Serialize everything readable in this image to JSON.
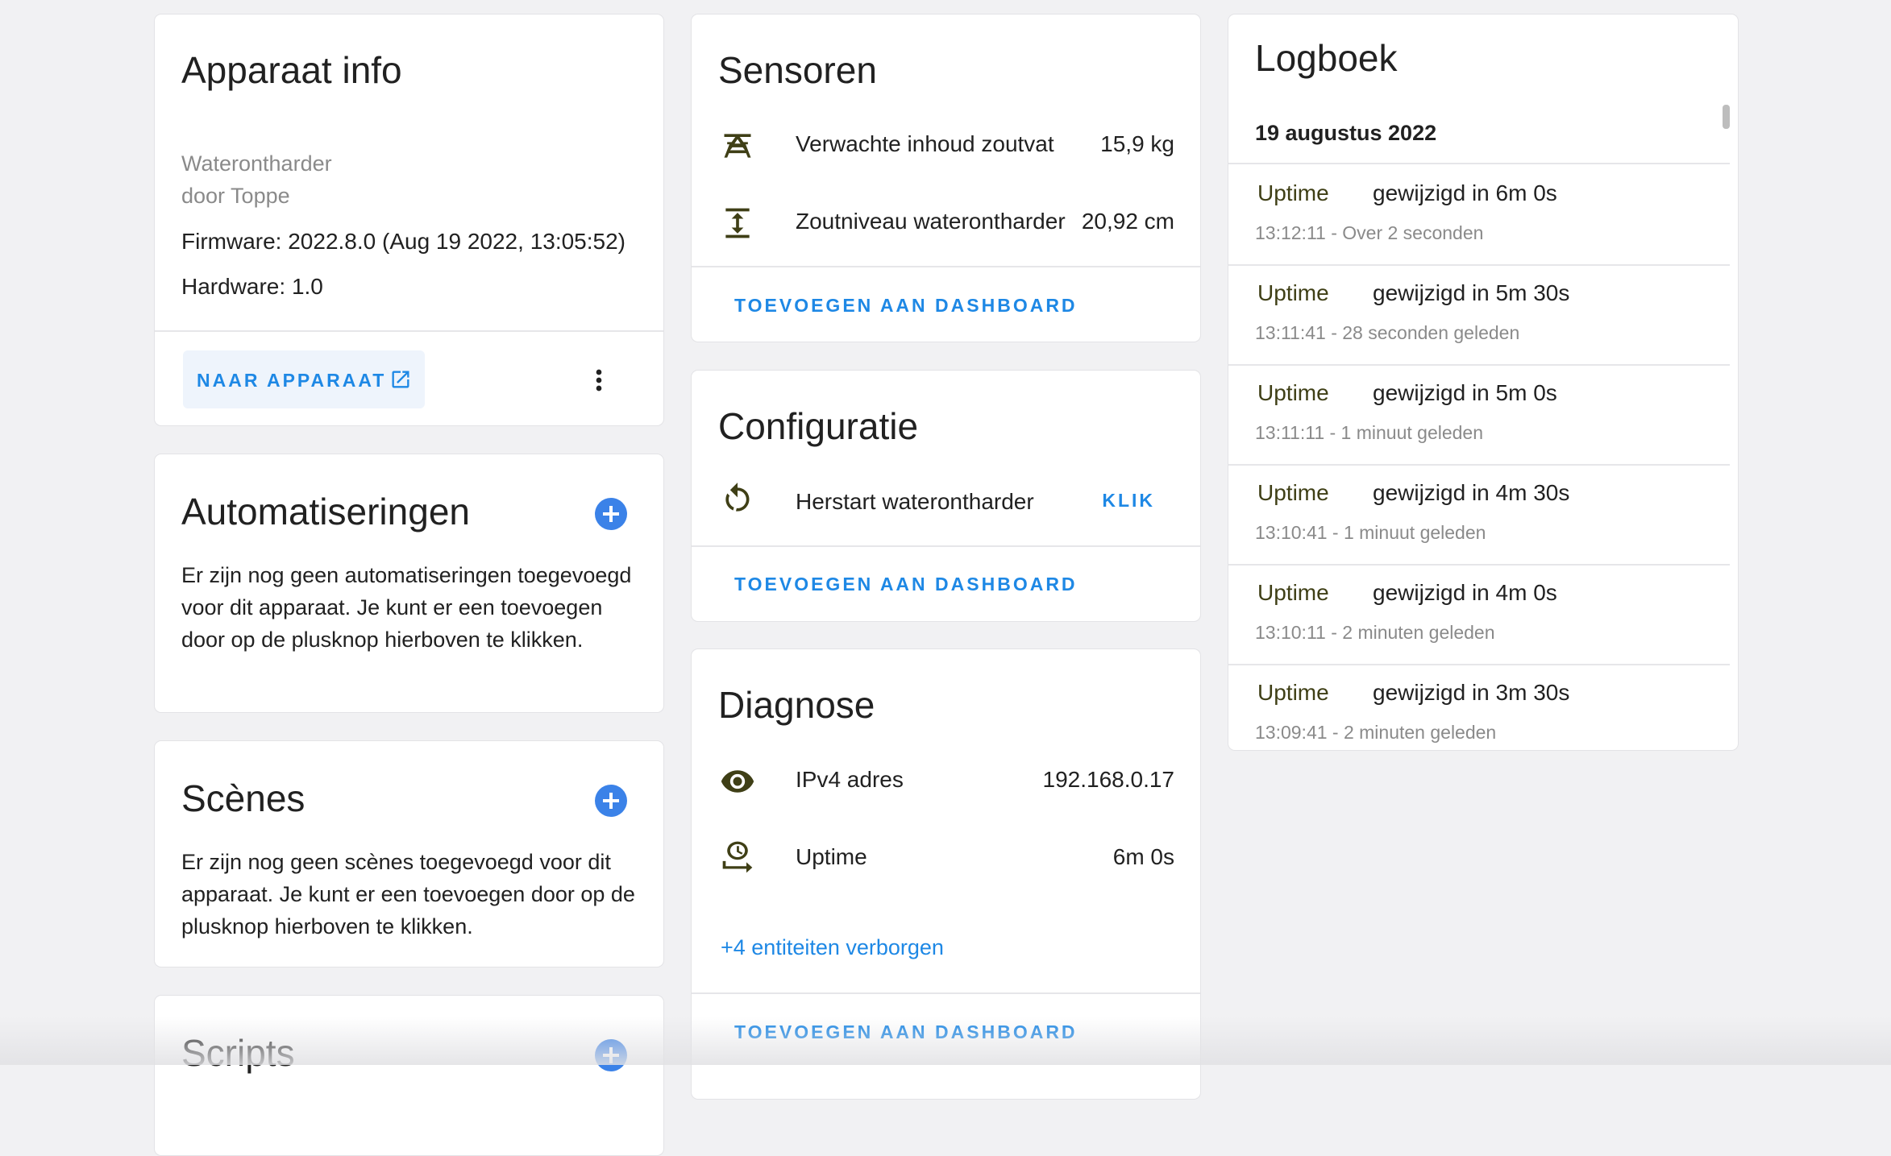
{
  "device_info": {
    "title": "Apparaat info",
    "model": "Waterontharder",
    "manufacturer": "door Toppe",
    "firmware": "Firmware: 2022.8.0 (Aug 19 2022, 13:05:52)",
    "hardware": "Hardware: 1.0",
    "goto_label": "NAAR APPARAAT",
    "external_icon": "open-in-new-icon",
    "menu_icon": "dots-vertical-icon"
  },
  "automations": {
    "title": "Automatiseringen",
    "text": "Er zijn nog geen automatiseringen toegevoegd voor dit apparaat. Je kunt er een toevoegen door op de plusknop hierboven te klikken."
  },
  "scenes": {
    "title": "Scènes",
    "text": "Er zijn nog geen scènes toegevoegd voor dit apparaat. Je kunt er een toevoegen door op de plusknop hierboven te klikken."
  },
  "scripts": {
    "title": "Scripts"
  },
  "sensors": {
    "title": "Sensoren",
    "rows": [
      {
        "icon": "scale-icon",
        "label": "Verwachte inhoud zoutvat",
        "value": "15,9 kg"
      },
      {
        "icon": "arrow-expand-vertical-icon",
        "label": "Zoutniveau waterontharder",
        "value": "20,92 cm"
      }
    ],
    "add_label": "TOEVOEGEN AAN DASHBOARD"
  },
  "config": {
    "title": "Configuratie",
    "rows": [
      {
        "icon": "restart-icon",
        "label": "Herstart waterontharder",
        "action": "KLIK"
      }
    ],
    "add_label": "TOEVOEGEN AAN DASHBOARD"
  },
  "diagnostics": {
    "title": "Diagnose",
    "rows": [
      {
        "icon": "eye-icon",
        "label": "IPv4 adres",
        "value": "192.168.0.17"
      },
      {
        "icon": "clock-timer-icon",
        "label": "Uptime",
        "value": "6m 0s"
      }
    ],
    "hidden_label": "+4 entiteiten verborgen",
    "add_label": "TOEVOEGEN AAN DASHBOARD"
  },
  "logbook": {
    "title": "Logboek",
    "date": "19 augustus 2022",
    "entries": [
      {
        "name": "Uptime",
        "message": "gewijzigd in 6m 0s",
        "time": "13:12:11 - Over 2 seconden"
      },
      {
        "name": "Uptime",
        "message": "gewijzigd in 5m 30s",
        "time": "13:11:41 - 28 seconden geleden"
      },
      {
        "name": "Uptime",
        "message": "gewijzigd in 5m 0s",
        "time": "13:11:11 - 1 minuut geleden"
      },
      {
        "name": "Uptime",
        "message": "gewijzigd in 4m 30s",
        "time": "13:10:41 - 1 minuut geleden"
      },
      {
        "name": "Uptime",
        "message": "gewijzigd in 4m 0s",
        "time": "13:10:11 - 2 minuten geleden"
      },
      {
        "name": "Uptime",
        "message": "gewijzigd in 3m 30s",
        "time": "13:09:41 - 2 minuten geleden"
      }
    ]
  },
  "colors": {
    "accent": "#1e88e5",
    "plus_button": "#3b82e8",
    "background": "#f1f1f3"
  }
}
